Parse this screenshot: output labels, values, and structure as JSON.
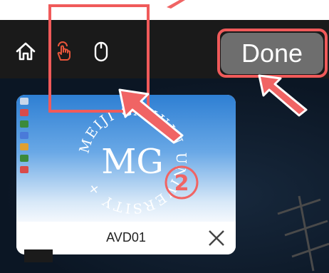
{
  "toolbar": {
    "home_icon": "home-icon",
    "touch_icon": "touch-hand-icon",
    "mouse_icon": "mouse-icon",
    "done_label": "Done"
  },
  "session_card": {
    "label": "AVD01",
    "close_icon": "close-icon",
    "logo_monogram": "MG",
    "logo_text": "MEIJI GAKUIN UNIVERSITY +"
  },
  "annotations": {
    "step_number": "2",
    "highlight_color": "#f05a5a",
    "arrow_color": "#f06464"
  },
  "colors": {
    "toolbar_bg": "#1a1a1a",
    "done_bg": "#6e6e6e",
    "desktop_bg": "#0f1d2e"
  }
}
